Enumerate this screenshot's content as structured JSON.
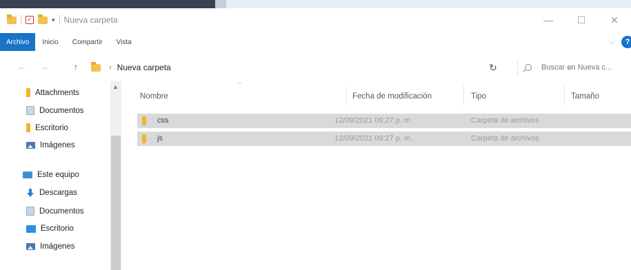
{
  "window": {
    "title": "Nueva carpeta",
    "minimize": "—",
    "maximize": "☐",
    "close": "✕"
  },
  "ribbon": {
    "tabs": [
      {
        "label": "Archivo",
        "active": true
      },
      {
        "label": "Inicio",
        "active": false
      },
      {
        "label": "Compartir",
        "active": false
      },
      {
        "label": "Vista",
        "active": false
      }
    ],
    "expand": "⌵",
    "help": "?"
  },
  "address": {
    "back": "←",
    "forward": "→",
    "up": "↑",
    "separator": "›",
    "crumb": "Nueva carpeta",
    "dropdown": "⌵",
    "refresh": "↻",
    "search_placeholder": "Buscar en Nueva c..."
  },
  "nav_pane": {
    "items": [
      {
        "label": "Attachments",
        "icon": "folder-icon"
      },
      {
        "label": "Documentos",
        "icon": "documents-icon"
      },
      {
        "label": "Escritorio",
        "icon": "folder-icon"
      },
      {
        "label": "Imágenes",
        "icon": "pictures-icon"
      },
      {
        "label": "Este equipo",
        "icon": "this-pc-icon"
      },
      {
        "label": "Descargas",
        "icon": "downloads-icon"
      },
      {
        "label": "Documentos",
        "icon": "documents-icon"
      },
      {
        "label": "Escritorio",
        "icon": "desktop-icon"
      },
      {
        "label": "Imágenes",
        "icon": "pictures-icon"
      }
    ],
    "scroll_up": "▲"
  },
  "file_list": {
    "columns": [
      "Nombre",
      "Fecha de modificación",
      "Tipo",
      "Tamaño"
    ],
    "sort_indicator": "^",
    "rows": [
      {
        "name": "css",
        "modified": "12/09/2021 09:27 p. m.",
        "type": "Carpeta de archivos",
        "size": ""
      },
      {
        "name": "js",
        "modified": "12/09/2021 09:27 p. m.",
        "type": "Carpeta de archivos",
        "size": ""
      }
    ]
  },
  "colors": {
    "accent": "#1a73c9",
    "selection": "#d9d9d9",
    "folder": "#f2b42d"
  }
}
